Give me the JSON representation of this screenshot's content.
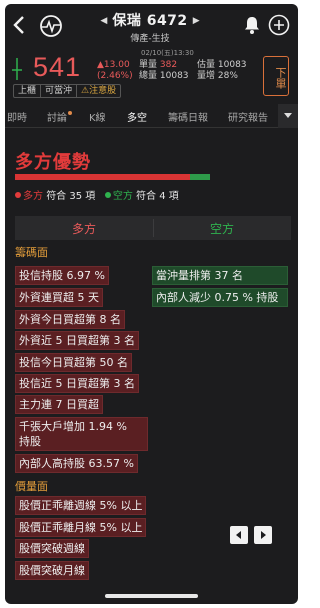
{
  "header": {
    "title": "保瑞 6472",
    "subtitle": "傳產-生技"
  },
  "quote": {
    "time": "02/10(五)13:30",
    "price": "541",
    "change": "▲13.00",
    "change_pct": "(2.46%)",
    "single_label": "單量",
    "single_value": "382",
    "total_label": "總量",
    "total_value": "10083",
    "est_label": "估量",
    "est_value": "10083",
    "ratio_label": "量增",
    "ratio_value": "28%",
    "order_label": "下單"
  },
  "badges": [
    "上櫃",
    "可當沖",
    "⚠注意股"
  ],
  "tabs": [
    "即時",
    "討論",
    "K線",
    "多空",
    "籌碼日報",
    "研究報告"
  ],
  "verdict": {
    "title": "多方優勢",
    "bull_label": "多方",
    "bull_text": "符合 35 項",
    "bear_label": "空方",
    "bear_text": "符合 4 項",
    "bull_count": 35,
    "bear_count": 4
  },
  "columns": {
    "bull": "多方",
    "bear": "空方"
  },
  "sections": {
    "chip": "籌碼面",
    "price": "價量面"
  },
  "chip_bull": [
    "投信持股 6.97 %",
    "外資連買超 5 天",
    "外資今日買超第 8 名",
    "外資近 5 日買超第 3 名",
    "投信今日買超第 50 名",
    "投信近 5 日買超第 3 名",
    "主力連 7 日買超",
    "千張大戶增加 1.94 %",
    "持股",
    "內部人高持股 63.57 %"
  ],
  "chip_bear": [
    "當沖量排第 37 名",
    "內部人減少 0.75 % 持股"
  ],
  "price_bull": [
    "股價正乖離週線 5% 以上",
    "股價正乖離月線 5% 以上",
    "股價突破週線",
    "股價突破月線"
  ],
  "colors": {
    "bull": "#e23b3b",
    "bear": "#2fb24e",
    "section": "#e39d3a",
    "background": "#1c1c1e"
  }
}
